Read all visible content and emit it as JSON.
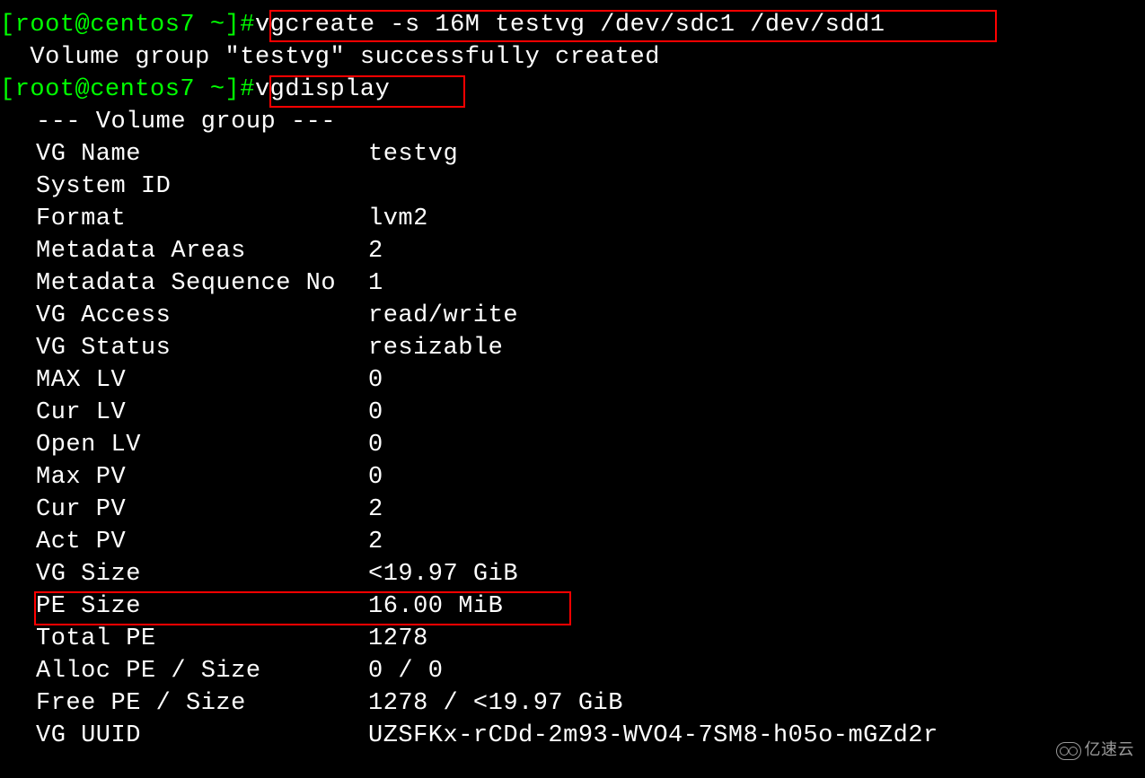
{
  "prompt": "[root@centos7 ~]#",
  "commands": {
    "vgcreate": "vgcreate -s 16M testvg /dev/sdc1 /dev/sdd1",
    "vgdisplay": "vgdisplay"
  },
  "output": {
    "create_success": "  Volume group \"testvg\" successfully created",
    "header": "--- Volume group ---"
  },
  "fields": [
    {
      "label": "VG Name",
      "value": "testvg"
    },
    {
      "label": "System ID",
      "value": ""
    },
    {
      "label": "Format",
      "value": "lvm2"
    },
    {
      "label": "Metadata Areas",
      "value": "2"
    },
    {
      "label": "Metadata Sequence No",
      "value": "1"
    },
    {
      "label": "VG Access",
      "value": "read/write"
    },
    {
      "label": "VG Status",
      "value": "resizable"
    },
    {
      "label": "MAX LV",
      "value": "0"
    },
    {
      "label": "Cur LV",
      "value": "0"
    },
    {
      "label": "Open LV",
      "value": "0"
    },
    {
      "label": "Max PV",
      "value": "0"
    },
    {
      "label": "Cur PV",
      "value": "2"
    },
    {
      "label": "Act PV",
      "value": "2"
    },
    {
      "label": "VG Size",
      "value": "<19.97 GiB"
    },
    {
      "label": "PE Size",
      "value": "16.00 MiB"
    },
    {
      "label": "Total PE",
      "value": "1278"
    },
    {
      "label": "Alloc PE / Size",
      "value": "0 / 0"
    },
    {
      "label": "Free  PE / Size",
      "value": "1278 / <19.97 GiB"
    },
    {
      "label": "VG UUID",
      "value": "UZSFKx-rCDd-2m93-WVO4-7SM8-h05o-mGZd2r"
    }
  ],
  "watermark": "亿速云"
}
